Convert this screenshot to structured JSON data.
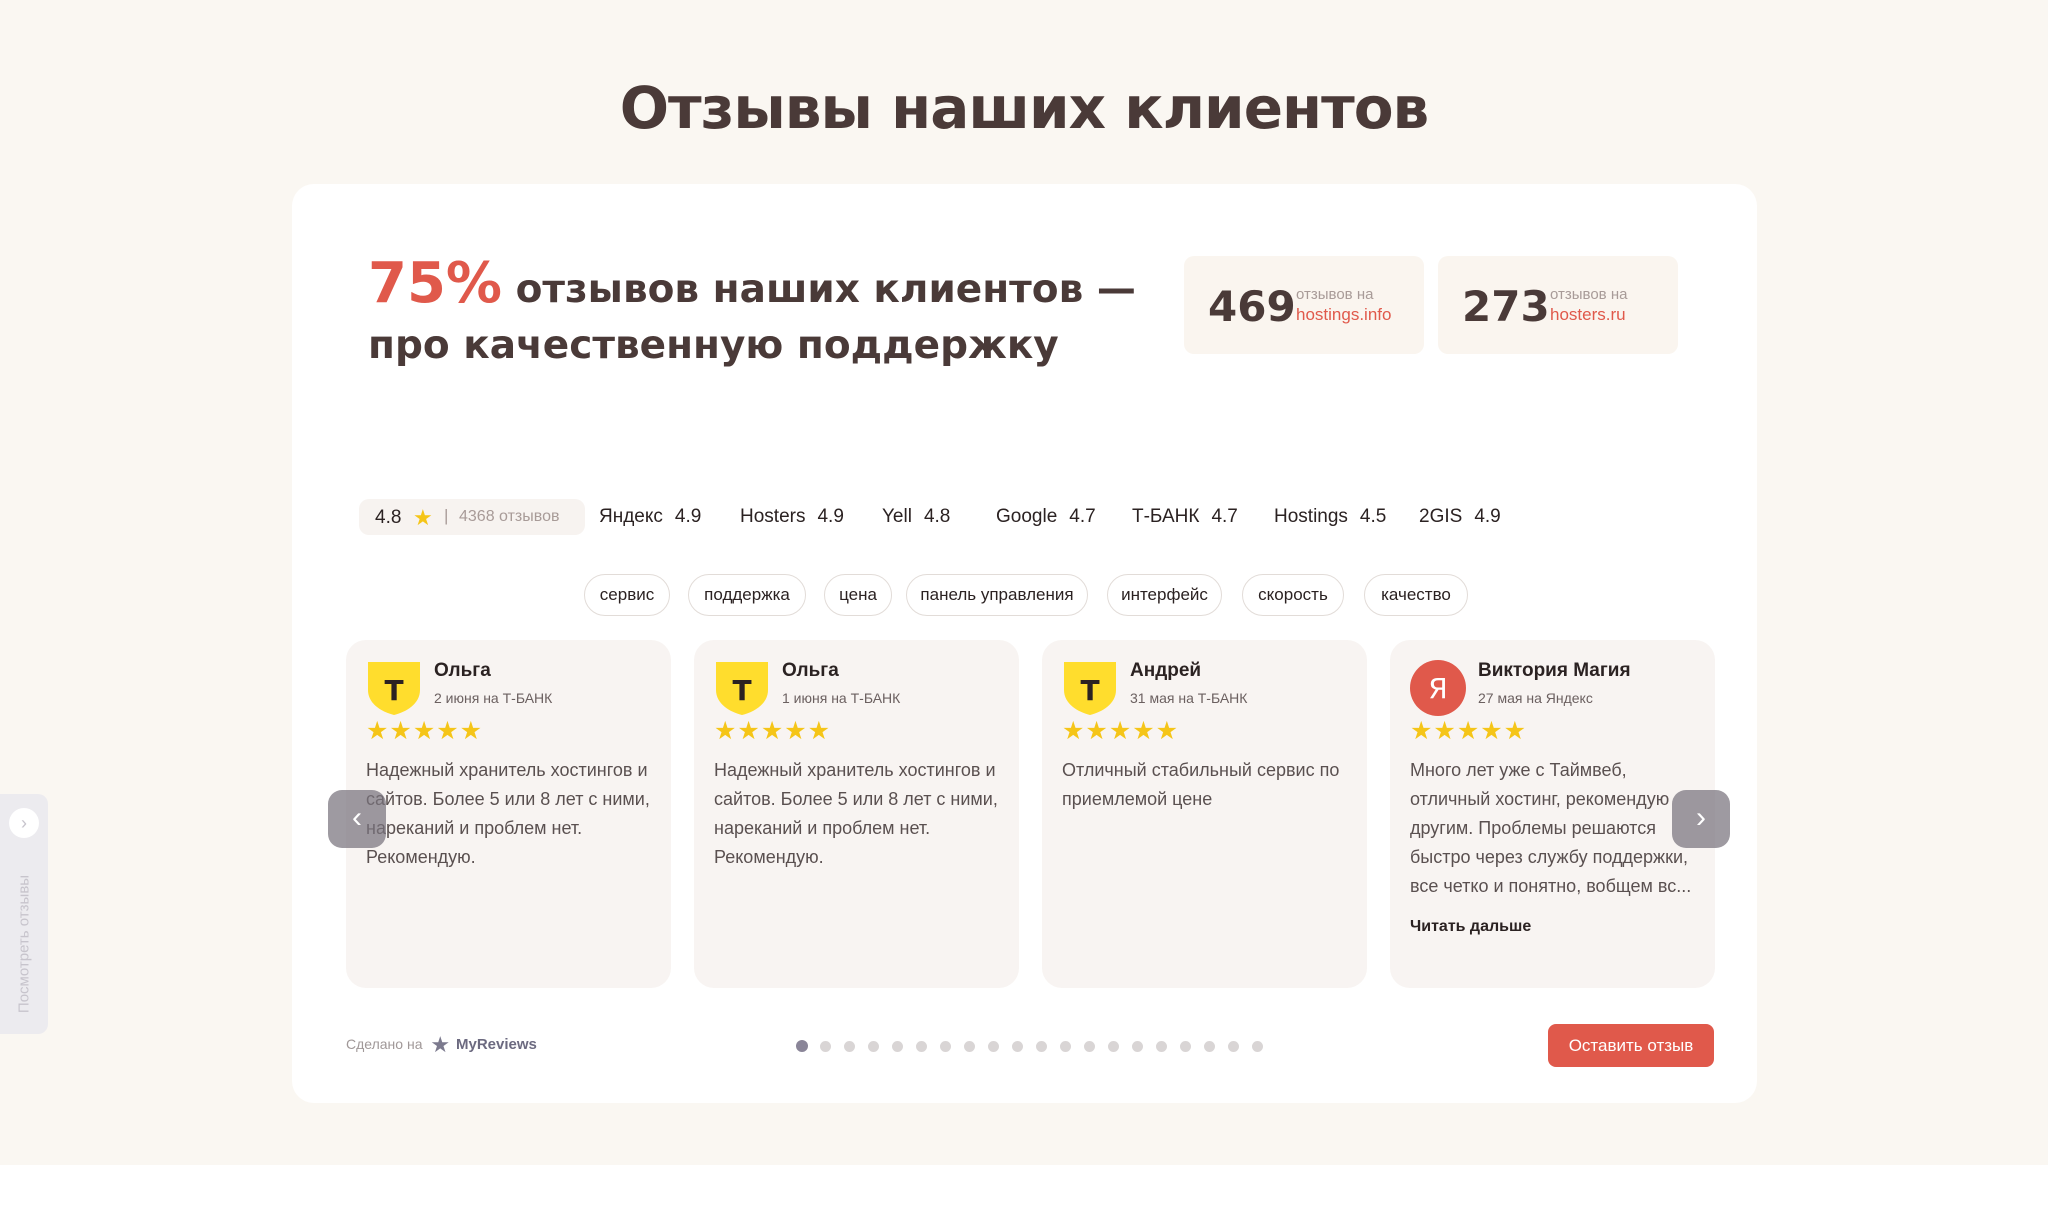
{
  "section_title": "Отзывы наших клиентов",
  "headline": {
    "percent": "75%",
    "text": "отзывов наших клиентов — про качественную поддержку"
  },
  "stats": [
    {
      "number": "469",
      "label": "отзывов на",
      "site": "hostings.info"
    },
    {
      "number": "273",
      "label": "отзывов на",
      "site": "hosters.ru"
    }
  ],
  "overall": {
    "rating": "4.8",
    "separator": "|",
    "count": "4368 отзывов"
  },
  "sources": [
    {
      "name": "Яндекс",
      "rating": "4.9"
    },
    {
      "name": "Hosters",
      "rating": "4.9"
    },
    {
      "name": "Yell",
      "rating": "4.8"
    },
    {
      "name": "Google",
      "rating": "4.7"
    },
    {
      "name": "Т-БАНК",
      "rating": "4.7"
    },
    {
      "name": "Hostings",
      "rating": "4.5"
    },
    {
      "name": "2GIS",
      "rating": "4.9"
    }
  ],
  "tags": [
    "сервис",
    "поддержка",
    "цена",
    "панель управления",
    "интерфейс",
    "скорость",
    "качество"
  ],
  "reviews": [
    {
      "name": "Ольга",
      "meta": "2 июня на Т-БАНК",
      "stars": "★★★★★",
      "avatar_letter": "T",
      "text": "Надежный хранитель хостингов и сайтов. Более 5 или 8 лет с ними, нареканий и проблем нет. Рекомендую."
    },
    {
      "name": "Ольга",
      "meta": "1 июня на Т-БАНК",
      "stars": "★★★★★",
      "avatar_letter": "T",
      "text": "Надежный хранитель хостингов и сайтов. Более 5 или 8 лет с ними, нареканий и проблем нет. Рекомендую."
    },
    {
      "name": "Андрей",
      "meta": "31 мая на Т-БАНК",
      "stars": "★★★★★",
      "avatar_letter": "T",
      "text": "Отличный стабильный сервис по приемлемой цене"
    },
    {
      "name": "Виктория Магия",
      "meta": "27 мая на Яндекс",
      "stars": "★★★★★",
      "avatar_letter": "Я",
      "text": "Много лет уже с Таймвеб, отличный хостинг, рекомендую другим. Проблемы решаются быстро через службу поддержки, все четко и понятно, вобщем вс...",
      "more": "Читать дальше"
    }
  ],
  "nav": {
    "prev": "‹",
    "next": "›"
  },
  "footer": {
    "made_on": "Сделано на",
    "brand": "MyReviews",
    "leave_button": "Оставить отзыв"
  },
  "pagination": {
    "total": 20,
    "current": 1
  },
  "side_tab": {
    "label": "Посмотреть отзывы",
    "icon": "›"
  },
  "colors": {
    "accent": "#e0594b",
    "star": "#f5c518",
    "tbank": "#ffdd2d",
    "yandex": "#e0594b"
  }
}
